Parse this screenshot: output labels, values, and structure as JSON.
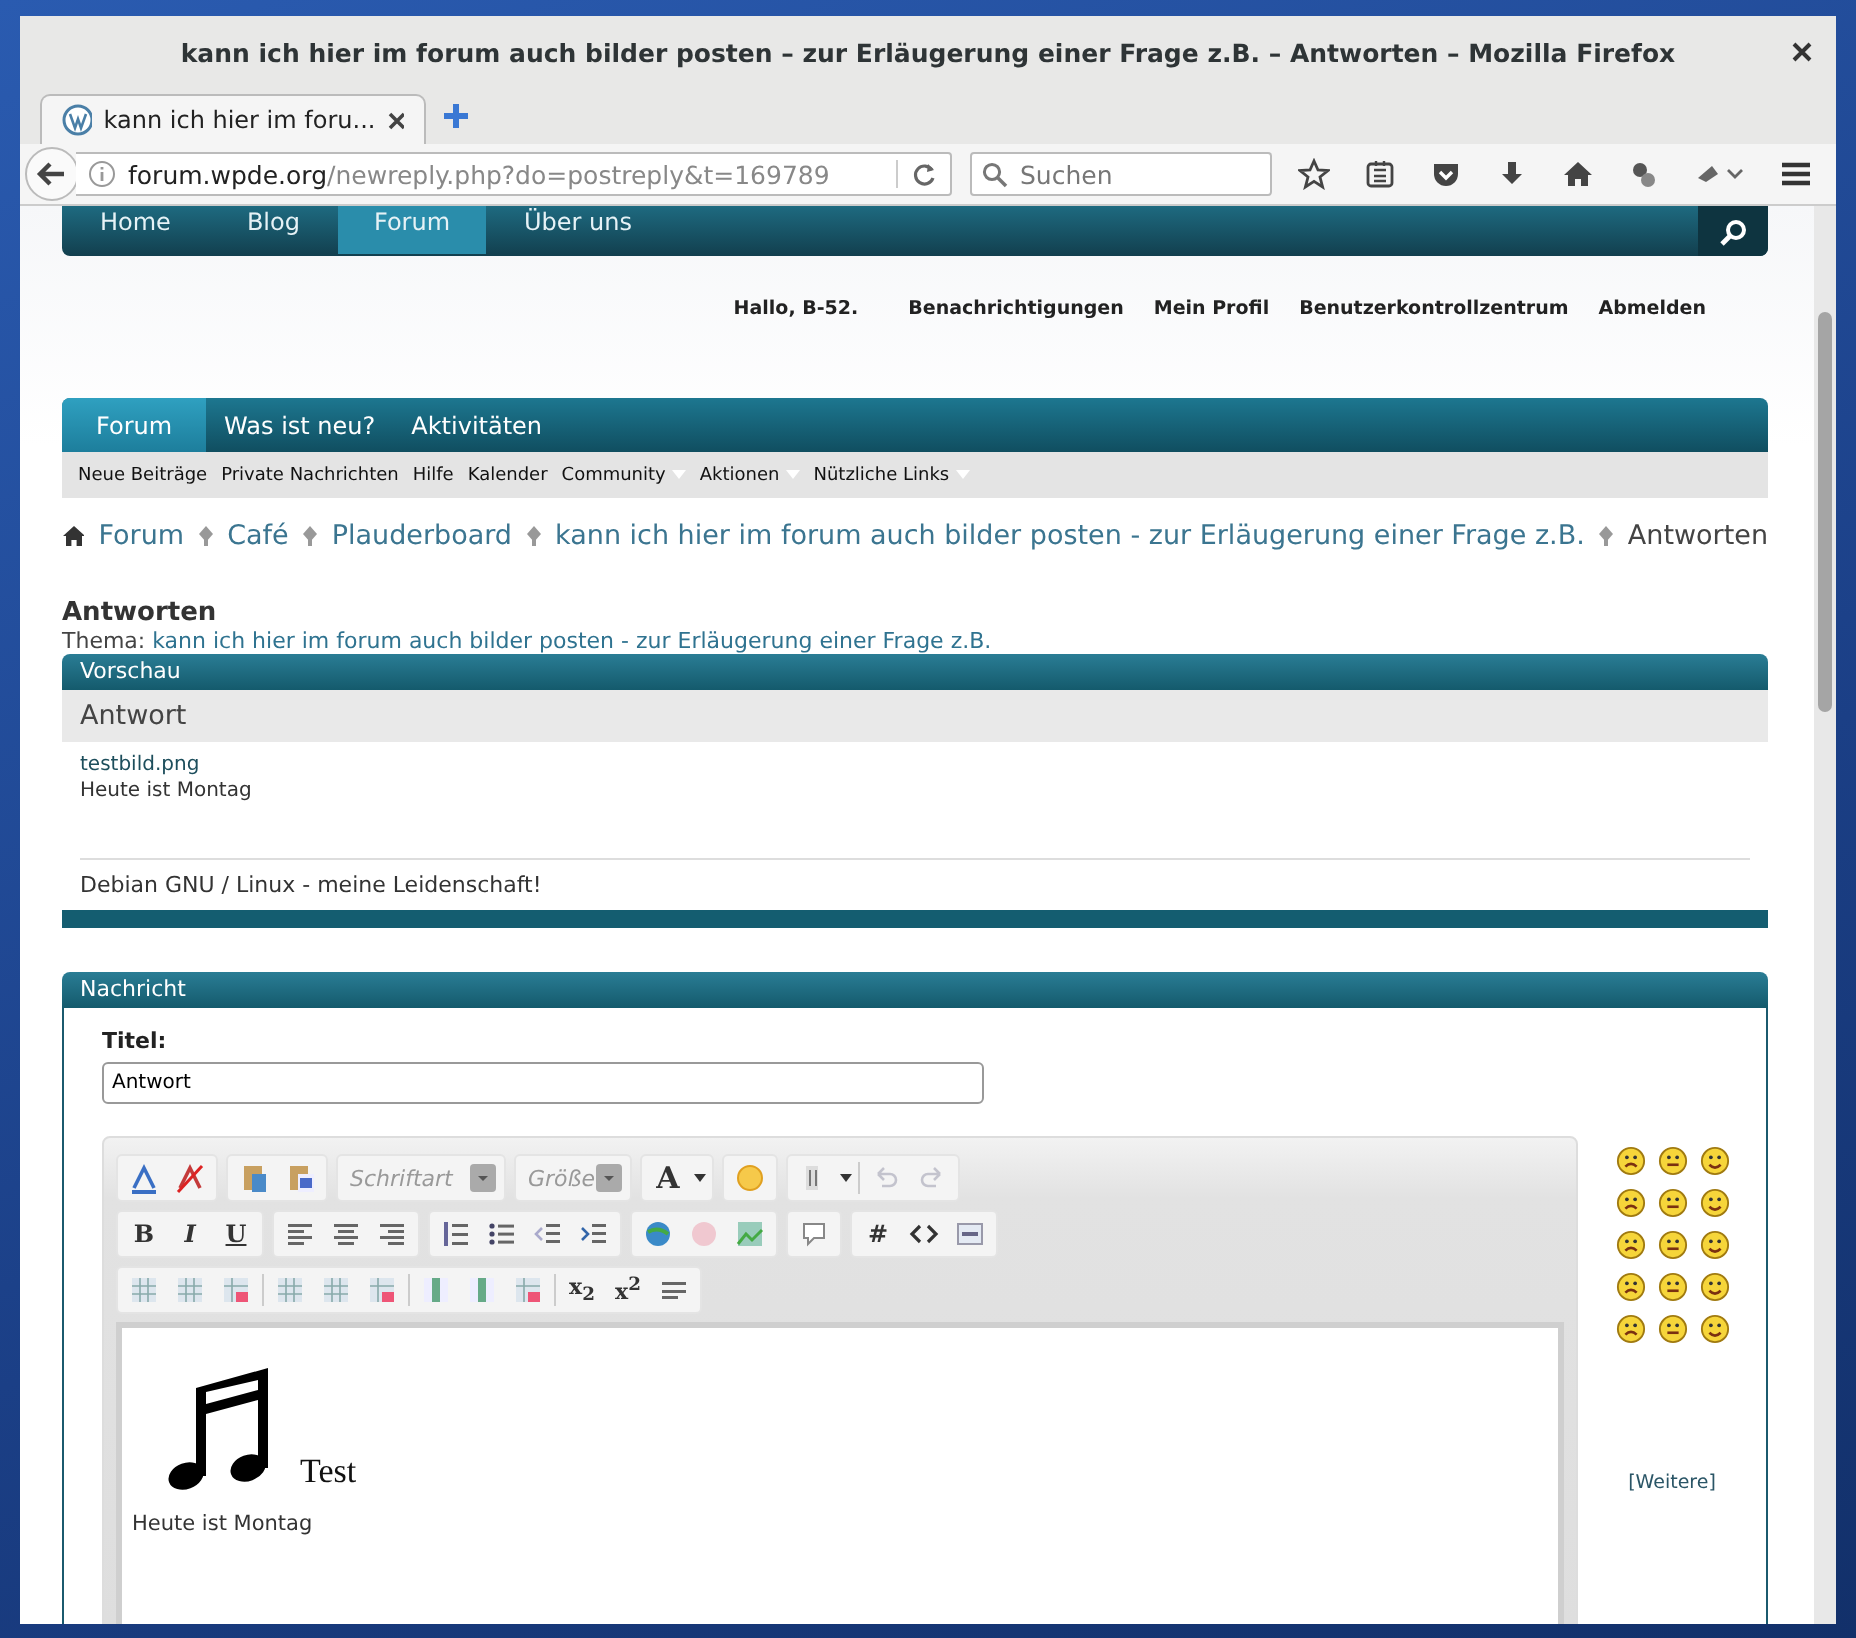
{
  "window": {
    "title": "kann ich hier im forum auch bilder posten – zur Erläugerung einer Frage z.B. – Antworten – Mozilla Firefox"
  },
  "browser": {
    "tabs": [
      {
        "title": "kann ich hier im foru...",
        "selected": true
      }
    ],
    "url": {
      "host": "forum.wpde.org",
      "path": "/newreply.php?do=postreply&t=169789"
    },
    "search": {
      "placeholder": "Suchen"
    }
  },
  "site_nav": [
    {
      "label": "Home",
      "selected": false
    },
    {
      "label": "Blog",
      "selected": false
    },
    {
      "label": "Forum",
      "selected": true
    },
    {
      "label": "Über uns",
      "selected": false
    }
  ],
  "greeting": "Hallo, B-52.",
  "user_links": [
    "Benachrichtigungen",
    "Mein Profil",
    "Benutzerkontrollzentrum",
    "Abmelden"
  ],
  "forum_tabs": [
    {
      "label": "Forum",
      "selected": true
    },
    {
      "label": "Was ist neu?",
      "selected": false
    },
    {
      "label": "Aktivitäten",
      "selected": false
    }
  ],
  "sub_nav": [
    {
      "label": "Neue Beiträge",
      "dropdown": false
    },
    {
      "label": "Private Nachrichten",
      "dropdown": false
    },
    {
      "label": "Hilfe",
      "dropdown": false
    },
    {
      "label": "Kalender",
      "dropdown": false
    },
    {
      "label": "Community",
      "dropdown": true
    },
    {
      "label": "Aktionen",
      "dropdown": true
    },
    {
      "label": "Nützliche Links",
      "dropdown": true
    }
  ],
  "breadcrumbs": [
    {
      "label": "Forum",
      "current": false
    },
    {
      "label": "Café",
      "current": false
    },
    {
      "label": "Plauderboard",
      "current": false
    },
    {
      "label": "kann ich hier im forum auch bilder posten - zur Erläugerung einer Frage z.B.",
      "current": false
    },
    {
      "label": "Antworten",
      "current": true
    }
  ],
  "page_title": "Antworten",
  "thread": {
    "label": "Thema:",
    "title": "kann ich hier im forum auch bilder posten - zur Erläugerung einer Frage z.B."
  },
  "preview": {
    "header": "Vorschau",
    "title": "Antwort",
    "attachment": "testbild.png",
    "body": "Heute ist Montag",
    "signature": "Debian GNU / Linux - meine Leidenschaft!"
  },
  "message": {
    "header": "Nachricht",
    "title_label": "Titel:",
    "title_value": "Antwort",
    "toolbar": {
      "font_select": "Schriftart",
      "size_select": "Größe",
      "text_size": "A",
      "bold": "B",
      "italic": "I",
      "underline": "U",
      "hash": "#",
      "subscript": "x$_{2}$",
      "superscript": "x$^{2}$",
      "undo": {
        "disabled": true
      },
      "redo": {
        "disabled": true
      }
    },
    "editor": {
      "caption": "Test",
      "body": "Heute ist Montag"
    },
    "smilies_more": "[Weitere]"
  }
}
